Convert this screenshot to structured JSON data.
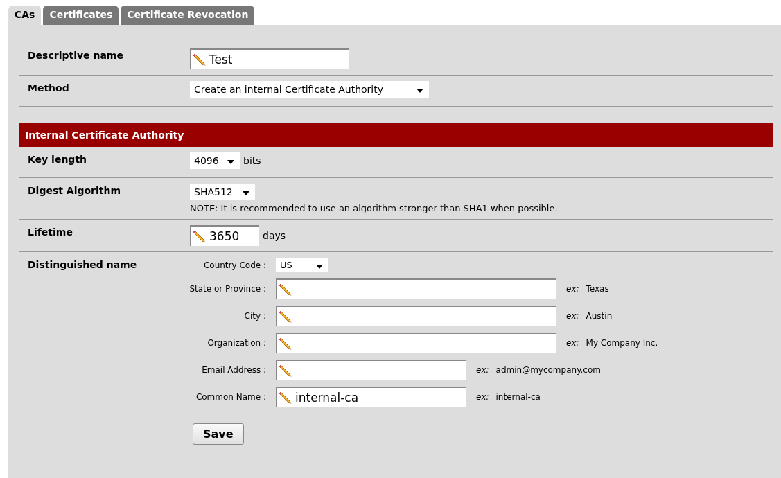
{
  "tabs": [
    {
      "label": "CAs",
      "selected": true
    },
    {
      "label": "Certificates",
      "selected": false
    },
    {
      "label": "Certificate Revocation",
      "selected": false
    }
  ],
  "general": [
    {
      "label": "Descriptive name",
      "kind": "text",
      "value": "Test"
    },
    {
      "label": "Method",
      "kind": "select",
      "value": "Create an internal Certificate Authority"
    }
  ],
  "section_title": "Internal Certificate Authority",
  "key_length": {
    "label": "Key length",
    "value": "4096",
    "unit": "bits"
  },
  "digest": {
    "label": "Digest Algorithm",
    "value": "SHA512",
    "note": "NOTE: It is recommended to use an algorithm stronger than SHA1 when possible."
  },
  "lifetime": {
    "label": "Lifetime",
    "value": "3650",
    "unit": "days"
  },
  "distinguished": {
    "label": "Distinguished name",
    "fields": [
      {
        "label": "Country Code :",
        "kind": "select",
        "value": "US"
      },
      {
        "label": "State or Province :",
        "kind": "text",
        "wide": true,
        "example_prefix": "ex:",
        "example": "Texas"
      },
      {
        "label": "City :",
        "kind": "text",
        "wide": true,
        "example_prefix": "ex:",
        "example": "Austin"
      },
      {
        "label": "Organization :",
        "kind": "text",
        "wide": true,
        "example_prefix": "ex:",
        "example": "My Company Inc."
      },
      {
        "label": "Email Address :",
        "kind": "text",
        "wide": false,
        "example_prefix": "ex:",
        "example": "admin@mycompany.com"
      },
      {
        "label": "Common Name :",
        "kind": "text",
        "wide": false,
        "value": "internal-ca",
        "example_prefix": "ex:",
        "example": "internal-ca"
      }
    ]
  },
  "save_button": "Save"
}
